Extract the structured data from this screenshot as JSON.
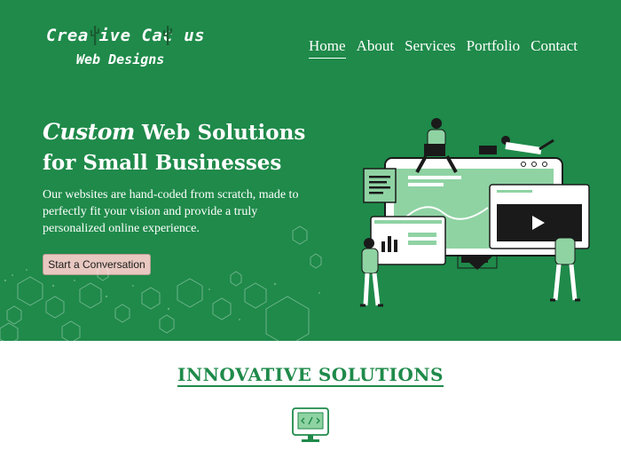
{
  "brand": {
    "name_line1": "Crea ive Cac us",
    "name_line2": "Web Designs"
  },
  "nav": {
    "items": [
      {
        "label": "Home",
        "active": true
      },
      {
        "label": "About",
        "active": false
      },
      {
        "label": "Services",
        "active": false
      },
      {
        "label": "Portfolio",
        "active": false
      },
      {
        "label": "Contact",
        "active": false
      }
    ]
  },
  "hero": {
    "headline_em": "Custom",
    "headline_rest": " Web Solutions",
    "headline_line2": "for Small Businesses",
    "blurb": "Our websites are hand-coded from scratch, made to perfectly fit your vision and provide a truly personalized online experience.",
    "cta_label": "Start a Conversation"
  },
  "section": {
    "title": "INNOVATIVE SOLUTIONS"
  },
  "colors": {
    "brand_green": "#1f8a4a",
    "light_green": "#8fd3a3",
    "cta_bg": "#e8c8c0",
    "white": "#ffffff"
  },
  "icons": [
    "cactus-icon",
    "web-illustration",
    "hexagon-pattern",
    "monitor-code-icon"
  ]
}
